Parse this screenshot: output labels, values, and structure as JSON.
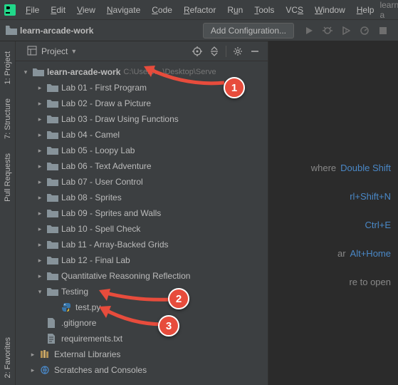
{
  "menubar": {
    "items": [
      {
        "label": "File",
        "u": 0
      },
      {
        "label": "Edit",
        "u": 0
      },
      {
        "label": "View",
        "u": 0
      },
      {
        "label": "Navigate",
        "u": 0
      },
      {
        "label": "Code",
        "u": 0
      },
      {
        "label": "Refactor",
        "u": 0
      },
      {
        "label": "Run",
        "u": 1
      },
      {
        "label": "Tools",
        "u": 0
      },
      {
        "label": "VCS",
        "u": 2
      },
      {
        "label": "Window",
        "u": 0
      },
      {
        "label": "Help",
        "u": 0
      }
    ],
    "app_name": "learn-a"
  },
  "toolbar": {
    "breadcrumb": "learn-arcade-work",
    "config_button": "Add Configuration..."
  },
  "left_rail": {
    "project": "1: Project",
    "structure": "7: Structure",
    "pull_requests": "Pull Requests",
    "favorites": "2: Favorites"
  },
  "panel": {
    "title": "Project"
  },
  "tree": {
    "root": {
      "label": "learn-arcade-work",
      "path": "C:\\Users\\...\\Desktop\\Serve"
    },
    "labs": [
      "Lab 01 - First Program",
      "Lab 02 - Draw a Picture",
      "Lab 03 - Draw Using Functions",
      "Lab 04 - Camel",
      "Lab 05 - Loopy Lab",
      "Lab 06 - Text Adventure",
      "Lab 07 - User Control",
      "Lab 08 - Sprites",
      "Lab 09 - Sprites and Walls",
      "Lab 10 - Spell Check",
      "Lab 11 - Array-Backed Grids",
      "Lab 12 - Final Lab",
      "Quantitative Reasoning Reflection"
    ],
    "testing": "Testing",
    "testpy": "test.py",
    "gitignore": ".gitignore",
    "requirements": "requirements.txt",
    "ext_lib": "External Libraries",
    "scratches": "Scratches and Consoles"
  },
  "hints": {
    "h1": {
      "text": "where",
      "shortcut": "Double Shift"
    },
    "h2": {
      "text": "",
      "shortcut": "rl+Shift+N"
    },
    "h3": {
      "text": "",
      "shortcut": "Ctrl+E"
    },
    "h4": {
      "text": "ar",
      "shortcut": "Alt+Home"
    },
    "h5": {
      "text": "re to open",
      "shortcut": ""
    }
  },
  "annotations": {
    "a1": "1",
    "a2": "2",
    "a3": "3"
  }
}
